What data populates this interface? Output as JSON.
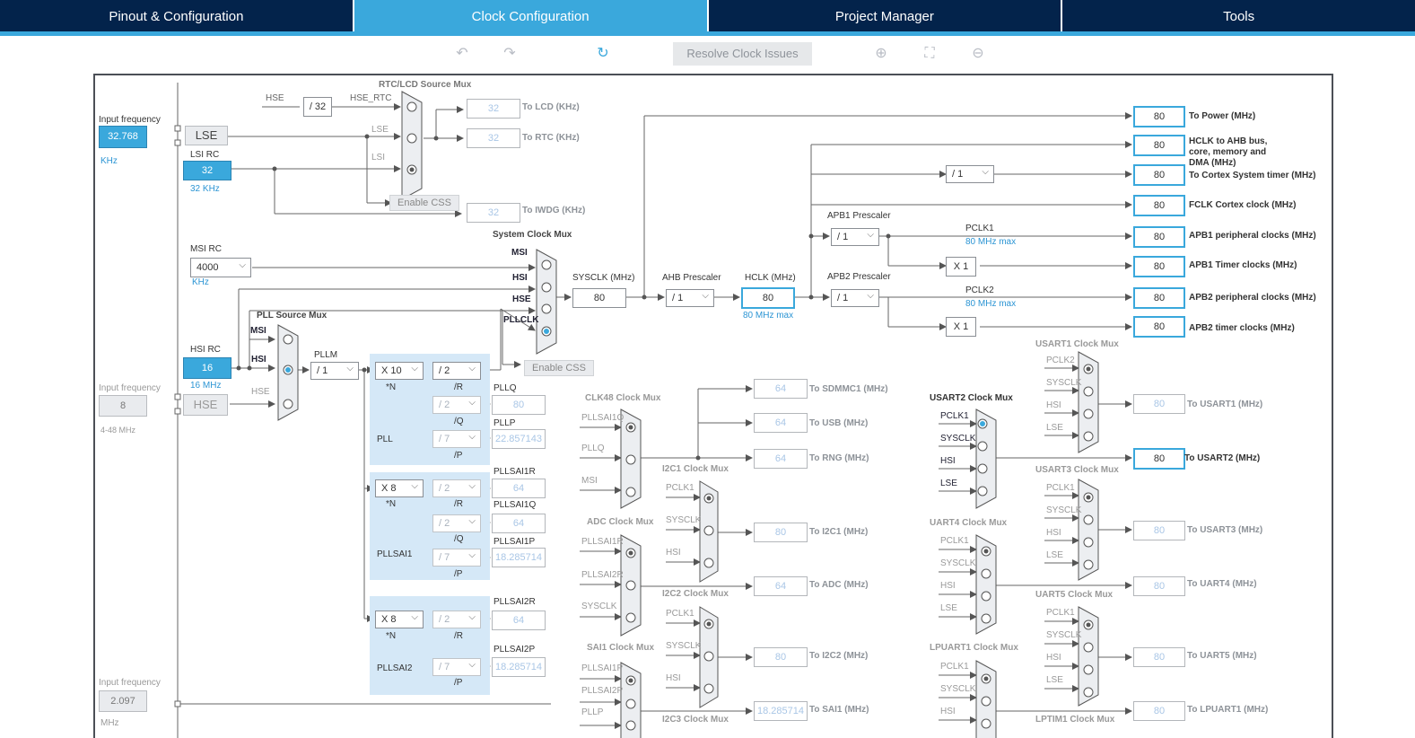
{
  "tabs": [
    "Pinout & Configuration",
    "Clock Configuration",
    "Project Manager",
    "Tools"
  ],
  "toolbar": {
    "resolve_label": "Resolve Clock Issues"
  },
  "icons": {
    "undo": "undo-icon",
    "redo": "redo-icon",
    "refresh": "refresh-icon",
    "zoom_in": "zoom-in-icon",
    "fit": "fit-icon",
    "zoom_out": "zoom-out-icon"
  },
  "colors": {
    "accent": "#3aa8dc",
    "navy": "#03234b"
  },
  "left": {
    "lse_input_label": "Input frequency",
    "lse_value": "32.768",
    "lse_unit": "KHz",
    "lse": "LSE",
    "lsi_label": "LSI RC",
    "lsi_value": "32",
    "lsi_unit": "32 KHz",
    "msi_label": "MSI RC",
    "msi_value": "4000",
    "msi_unit": "KHz",
    "hsi_label": "HSI RC",
    "hsi_value": "16",
    "hsi_unit": "16 MHz",
    "hse_input_label": "Input frequency",
    "hse_value": "8",
    "hse_range": "4-48 MHz",
    "hse": "HSE",
    "ext_input_label": "Input frequency",
    "ext_value": "2.097",
    "ext_unit": "MHz"
  },
  "rtc": {
    "title": "RTC/LCD Source Mux",
    "hse": "HSE",
    "div32": "/ 32",
    "hse_rtc": "HSE_RTC",
    "lse": "LSE",
    "lsi": "LSI",
    "enable_css": "Enable CSS",
    "lcd_value": "32",
    "lcd_label": "To LCD (KHz)",
    "rtc_value": "32",
    "rtc_label": "To RTC (KHz)",
    "iwdg_value": "32",
    "iwdg_label": "To IWDG (KHz)"
  },
  "sysmux": {
    "title": "System Clock Mux",
    "msi": "MSI",
    "hsi": "HSI",
    "hse": "HSE",
    "pllclk": "PLLCLK",
    "enable_css": "Enable CSS",
    "sysclk_label": "SYSCLK (MHz)",
    "sysclk_value": "80",
    "ahb_label": "AHB Prescaler",
    "ahb_value": "/ 1",
    "hclk_label": "HCLK (MHz)",
    "hclk_value": "80",
    "hclk_max": "80 MHz max"
  },
  "pll": {
    "src_title": "PLL Source Mux",
    "msi": "MSI",
    "hsi": "HSI",
    "hse": "HSE",
    "pllm_label": "PLLM",
    "pllm_value": "/ 1",
    "n": "X 10",
    "n_lbl": "*N",
    "r": "/ 2",
    "r_lbl": "/R",
    "q": "/ 2",
    "q_lbl": "/Q",
    "p": "/ 7",
    "p_lbl": "/P",
    "name": "PLL",
    "pllq_label": "PLLQ",
    "pllq_value": "80",
    "pllp_label": "PLLP",
    "pllp_value": "22.857143"
  },
  "pllsai1": {
    "n": "X 8",
    "n_lbl": "*N",
    "r": "/ 2",
    "r_lbl": "/R",
    "q": "/ 2",
    "q_lbl": "/Q",
    "p": "/ 7",
    "p_lbl": "/P",
    "name": "PLLSAI1",
    "r_label": "PLLSAI1R",
    "r_value": "64",
    "q_label": "PLLSAI1Q",
    "q_value": "64",
    "p_label": "PLLSAI1P",
    "p_value": "18.285714"
  },
  "pllsai2": {
    "n": "X 8",
    "n_lbl": "*N",
    "r": "/ 2",
    "r_lbl": "/R",
    "p": "/ 7",
    "p_lbl": "/P",
    "name": "PLLSAI2",
    "r_label": "PLLSAI2R",
    "r_value": "64",
    "p_label": "PLLSAI2P",
    "p_value": "18.285714"
  },
  "outputs": [
    {
      "value": "80",
      "label": "To Power (MHz)"
    },
    {
      "value": "80",
      "label": "HCLK to AHB bus, core, memory and DMA (MHz)"
    },
    {
      "value": "80",
      "label": "To Cortex System timer (MHz)"
    },
    {
      "value": "80",
      "label": "FCLK Cortex clock (MHz)"
    },
    {
      "value": "80",
      "label": "APB1 peripheral clocks (MHz)"
    },
    {
      "value": "80",
      "label": "APB1 Timer clocks (MHz)"
    },
    {
      "value": "80",
      "label": "APB2 peripheral clocks (MHz)"
    },
    {
      "value": "80",
      "label": "APB2 timer clocks (MHz)"
    }
  ],
  "apb": {
    "cortex_div": "/ 1",
    "apb1_label": "APB1 Prescaler",
    "apb1_value": "/ 1",
    "pclk1": "PCLK1",
    "pclk1_max": "80 MHz max",
    "x1a": "X 1",
    "apb2_label": "APB2 Prescaler",
    "apb2_value": "/ 1",
    "pclk2": "PCLK2",
    "pclk2_max": "80 MHz max",
    "x1b": "X 1"
  },
  "clk48": {
    "title": "CLK48 Clock Mux",
    "in1": "PLLSAI1Q",
    "in2": "PLLQ",
    "in3": "MSI",
    "sdmmc_value": "64",
    "sdmmc_label": "To SDMMC1 (MHz)",
    "usb_value": "64",
    "usb_label": "To USB (MHz)",
    "rng_value": "64",
    "rng_label": "To RNG (MHz)"
  },
  "adc": {
    "title": "ADC Clock Mux",
    "in1": "PLLSAI1R",
    "in2": "PLLSAI2R",
    "in3": "SYSCLK",
    "value": "64",
    "label": "To ADC (MHz)"
  },
  "sai1": {
    "title": "SAI1 Clock Mux",
    "in1": "PLLSAI1P",
    "in2": "PLLSAI2P",
    "in3": "PLLP",
    "value": "18.285714",
    "label": "To SAI1 (MHz)"
  },
  "i2c1": {
    "title": "I2C1 Clock Mux",
    "in1": "PCLK1",
    "in2": "SYSCLK",
    "in3": "HSI",
    "value": "80",
    "label": "To I2C1 (MHz)"
  },
  "i2c2": {
    "title": "I2C2 Clock Mux",
    "in1": "PCLK1",
    "in2": "SYSCLK",
    "in3": "HSI",
    "value": "80",
    "label": "To I2C2 (MHz)"
  },
  "i2c3": {
    "title": "I2C3 Clock Mux"
  },
  "usart1": {
    "title": "USART1 Clock Mux",
    "in1": "PCLK2",
    "in2": "SYSCLK",
    "in3": "HSI",
    "in4": "LSE",
    "value": "80",
    "label": "To USART1 (MHz)"
  },
  "usart2": {
    "title": "USART2 Clock Mux",
    "in1": "PCLK1",
    "in2": "SYSCLK",
    "in3": "HSI",
    "in4": "LSE",
    "value": "80",
    "label": "To USART2 (MHz)"
  },
  "usart3": {
    "title": "USART3 Clock Mux",
    "in1": "PCLK1",
    "in2": "SYSCLK",
    "in3": "HSI",
    "in4": "LSE",
    "value": "80",
    "label": "To USART3 (MHz)"
  },
  "uart4": {
    "title": "UART4 Clock Mux",
    "in1": "PCLK1",
    "in2": "SYSCLK",
    "in3": "HSI",
    "in4": "LSE",
    "value": "80",
    "label": "To UART4 (MHz)"
  },
  "uart5": {
    "title": "UART5 Clock Mux",
    "in1": "PCLK1",
    "in2": "SYSCLK",
    "in3": "HSI",
    "in4": "LSE",
    "value": "80",
    "label": "To UART5 (MHz)"
  },
  "lpuart1": {
    "title": "LPUART1 Clock Mux",
    "in1": "PCLK1",
    "in2": "SYSCLK",
    "in3": "HSI",
    "value": "80",
    "label": "To LPUART1 (MHz)"
  },
  "lptim1": {
    "title": "LPTIM1 Clock Mux"
  }
}
